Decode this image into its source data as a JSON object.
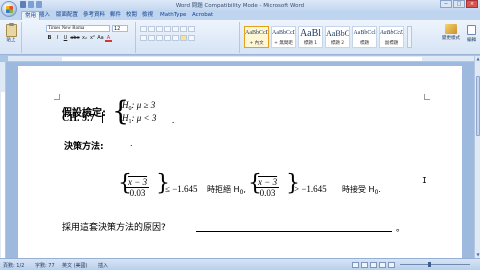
{
  "window": {
    "title": "Word 問題 Compatibility Mode - Microsoft Word",
    "controls": [
      "−",
      "□",
      "×"
    ]
  },
  "tabs": [
    {
      "label": "常用",
      "active": true
    },
    {
      "label": "插入",
      "active": false
    },
    {
      "label": "版面配置",
      "active": false
    },
    {
      "label": "參考資料",
      "active": false
    },
    {
      "label": "郵件",
      "active": false
    },
    {
      "label": "校閱",
      "active": false
    },
    {
      "label": "檢視",
      "active": false
    },
    {
      "label": "MathType",
      "active": false
    },
    {
      "label": "Acrobat",
      "active": false
    }
  ],
  "ribbon": {
    "paste_label": "貼上",
    "font_name": "Times New Roma",
    "font_size": "12",
    "format_buttons": [
      "B",
      "I",
      "U",
      "abe",
      "x₂",
      "x²",
      "Aa",
      "A"
    ],
    "styles": [
      {
        "sample": "AaBbCcD",
        "name": "+ 內文",
        "selected": true
      },
      {
        "sample": "AaBbCcD",
        "name": "+ 無間距",
        "selected": false
      },
      {
        "sample": "AaBl",
        "name": "標題 1",
        "selected": false
      },
      {
        "sample": "AaBbC",
        "name": "標題 2",
        "selected": false
      },
      {
        "sample": "AaBbCcl",
        "name": "標題",
        "selected": false
      },
      {
        "sample": "AaBbCcD",
        "name": "副標題",
        "selected": false
      }
    ],
    "change_styles_label": "變更樣式",
    "edit_label": "編輯"
  },
  "document": {
    "heading": "CH. 9.7",
    "hypothesis_label": "假設檢定:",
    "h0": {
      "var": "H",
      "sub": "0",
      "rel": ": μ ≥ 3"
    },
    "h1": {
      "var": "H",
      "sub": "1",
      "rel": ": μ < 3"
    },
    "h_end": ".",
    "decision_label": "決策方法:",
    "decision_end": ".",
    "rule1": {
      "num": "x − 3",
      "den": "0.03",
      "rhs": "≤ −1.645",
      "action": "時拒絕 H",
      "action_sub": "0",
      "sep": ","
    },
    "rule2": {
      "num": "x − 3",
      "den": "0.03",
      "rhs": "> −1.645",
      "action": "時接受 H",
      "action_sub": "0",
      "end": "."
    },
    "question": "採用這套決策方法的原因?",
    "question_end": "。"
  },
  "status": {
    "page": "頁數: 1/2",
    "words": "字數: 77",
    "language": "英文 (美國)",
    "mode": "插入"
  },
  "colors": {
    "chrome": "#bfd4ef",
    "page": "#ffffff",
    "doc_background": "#9eb9de",
    "selected_style": "#e3a21a"
  }
}
